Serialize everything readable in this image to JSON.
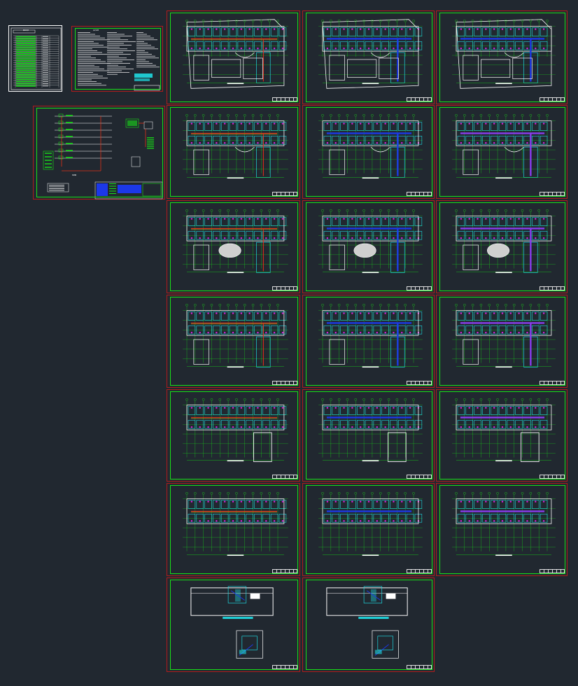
{
  "canvas": {
    "background": "#212830"
  },
  "colors": {
    "sheet_frame": "#b01c1c",
    "inner_border": "#18e018",
    "wall": "#ffffff",
    "room": "#1fd8e0",
    "axis": "#18e018",
    "device": "#e020e0",
    "cable_red": "#e03018",
    "cable_yellow": "#e8d020",
    "cable_blue": "#1c38e8",
    "cable_violet": "#8a3cf0"
  },
  "index_sheet": {
    "title": "图纸目录",
    "rows": [
      "",
      "",
      "",
      "",
      "",
      "",
      "",
      "",
      "",
      "",
      "",
      "",
      "",
      "",
      "",
      "",
      "",
      "",
      "",
      "",
      "",
      "",
      ""
    ]
  },
  "notes_sheet": {
    "title": "设计说明"
  },
  "riser_sheet": {
    "title": "系统图"
  },
  "sheets": [
    {
      "id": "01",
      "kind": "site",
      "cable": "red",
      "title": ""
    },
    {
      "id": "02",
      "kind": "site",
      "cable": "blue",
      "title": ""
    },
    {
      "id": "03",
      "kind": "site",
      "cable": "blue",
      "title": ""
    },
    {
      "id": "04",
      "kind": "floorL",
      "cable": "red",
      "title": ""
    },
    {
      "id": "05",
      "kind": "floorL",
      "cable": "blue",
      "title": ""
    },
    {
      "id": "06",
      "kind": "floorL",
      "cable": "violet",
      "title": ""
    },
    {
      "id": "07",
      "kind": "floorOval",
      "cable": "red",
      "title": ""
    },
    {
      "id": "08",
      "kind": "floorOval",
      "cable": "blue",
      "title": ""
    },
    {
      "id": "09",
      "kind": "floorOval",
      "cable": "violet",
      "title": ""
    },
    {
      "id": "10",
      "kind": "floorBox",
      "cable": "red",
      "title": ""
    },
    {
      "id": "11",
      "kind": "floorBox",
      "cable": "blue",
      "title": ""
    },
    {
      "id": "12",
      "kind": "floorBox",
      "cable": "violet",
      "title": ""
    },
    {
      "id": "13",
      "kind": "floorWing",
      "cable": "red",
      "title": ""
    },
    {
      "id": "14",
      "kind": "floorWing",
      "cable": "blue",
      "title": ""
    },
    {
      "id": "15",
      "kind": "floorWing",
      "cable": "violet",
      "title": ""
    },
    {
      "id": "16",
      "kind": "floorTop",
      "cable": "red",
      "title": ""
    },
    {
      "id": "17",
      "kind": "floorTop",
      "cable": "blue",
      "title": ""
    },
    {
      "id": "18",
      "kind": "floorTop",
      "cable": "violet",
      "title": ""
    },
    {
      "id": "19",
      "kind": "roof",
      "cable": "blue",
      "title": ""
    },
    {
      "id": "20",
      "kind": "roof",
      "cable": "blue",
      "title": ""
    }
  ]
}
